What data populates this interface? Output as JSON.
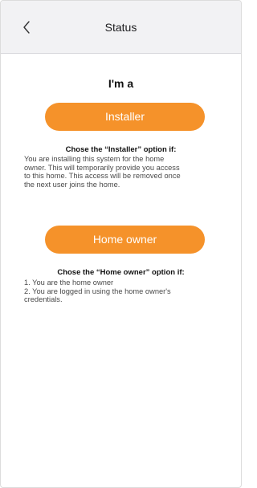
{
  "nav": {
    "back_icon": "chevron-left-icon",
    "title": "Status"
  },
  "heading": "I'm a",
  "installer": {
    "button_label": "Installer",
    "option_title": "Chose the “Installer” option if:",
    "description_lines": [
      "You are installing this system for the home",
      "owner. This will temporarily provide you access",
      "to this home. This access will be removed once",
      "the next user joins the home."
    ]
  },
  "home_owner": {
    "button_label": "Home owner",
    "option_title": "Chose the “Home owner” option if:",
    "description_lines": [
      "1. You are the home owner",
      "2. You are logged in using the home owner's",
      "credentials."
    ]
  },
  "colors": {
    "accent": "#f5922a",
    "nav_bg": "#f2f2f4"
  }
}
